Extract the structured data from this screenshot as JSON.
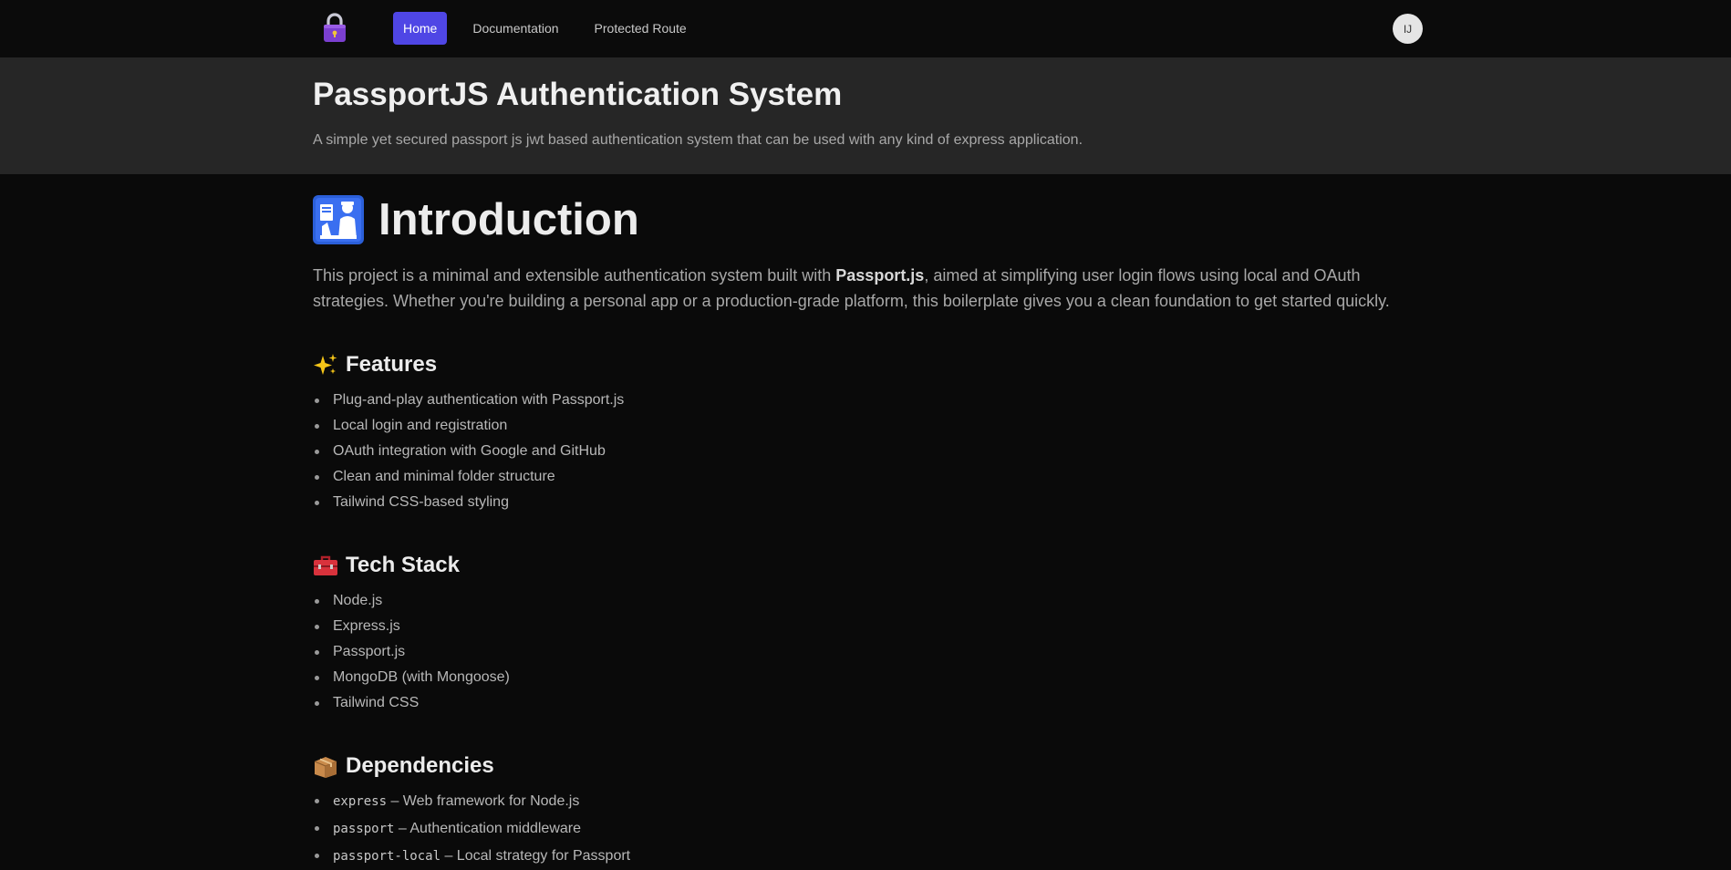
{
  "nav": {
    "logo_icon": "padlock-icon",
    "links": [
      {
        "label": "Home",
        "active": true
      },
      {
        "label": "Documentation",
        "active": false
      },
      {
        "label": "Protected Route",
        "active": false
      }
    ],
    "avatar_initials": "IJ",
    "active_color": "#4f46e5"
  },
  "hero": {
    "title": "PassportJS Authentication System",
    "subtitle": "A simple yet secured passport js jwt based authentication system that can be used with any kind of express application."
  },
  "intro": {
    "icon": "passport-control-icon",
    "heading": "Introduction",
    "text_before": "This project is a minimal and extensible authentication system built with ",
    "text_bold": "Passport.js",
    "text_after": ", aimed at simplifying user login flows using local and OAuth strategies. Whether you're building a personal app or a production-grade platform, this boilerplate gives you a clean foundation to get started quickly."
  },
  "features": {
    "emoji": "✨",
    "heading": "Features",
    "items": [
      "Plug-and-play authentication with Passport.js",
      "Local login and registration",
      "OAuth integration with Google and GitHub",
      "Clean and minimal folder structure",
      "Tailwind CSS-based styling"
    ]
  },
  "tech_stack": {
    "emoji": "🧰",
    "heading": "Tech Stack",
    "items": [
      "Node.js",
      "Express.js",
      "Passport.js",
      "MongoDB (with Mongoose)",
      "Tailwind CSS"
    ]
  },
  "dependencies": {
    "emoji": "📦",
    "heading": "Dependencies",
    "items": [
      {
        "code": "express",
        "desc": " – Web framework for Node.js"
      },
      {
        "code": "passport",
        "desc": " – Authentication middleware"
      },
      {
        "code": "passport-local",
        "desc": " – Local strategy for Passport"
      }
    ]
  }
}
